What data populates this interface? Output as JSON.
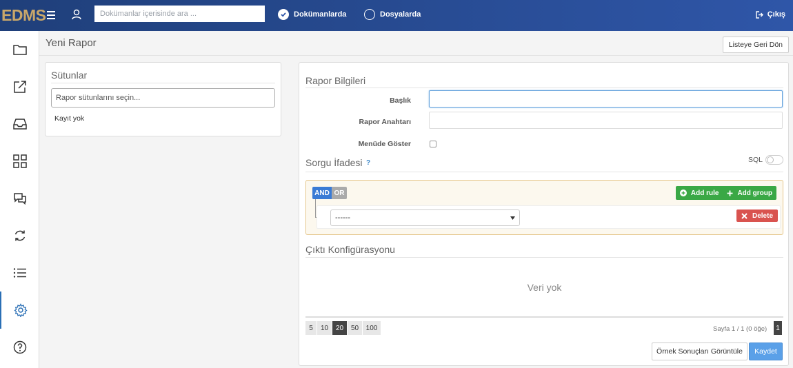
{
  "app": {
    "logo": "EDMS"
  },
  "topbar": {
    "search_placeholder": "Dokümanlar içerisinde ara ...",
    "radio_documents": "Dokümanlarda",
    "radio_files": "Dosyalarda",
    "logout": "Çıkış",
    "icons": [
      "menu-icon",
      "user-icon",
      "logout-icon"
    ]
  },
  "sidebar": {
    "items": [
      {
        "icon": "folder-icon"
      },
      {
        "icon": "share-icon"
      },
      {
        "icon": "inbox-icon"
      },
      {
        "icon": "grid-icon"
      },
      {
        "icon": "chat-icon"
      },
      {
        "icon": "sync-icon"
      },
      {
        "icon": "list-icon"
      },
      {
        "icon": "gear-icon",
        "active": true
      },
      {
        "icon": "help-icon"
      }
    ]
  },
  "header": {
    "title": "Yeni Rapor",
    "back_button": "Listeye Geri Dön"
  },
  "columns_panel": {
    "title": "Sütunlar",
    "input_placeholder": "Rapor sütunlarını seçin...",
    "empty": "Kayıt yok"
  },
  "report_info": {
    "title": "Rapor Bilgileri",
    "title_label": "Başlık",
    "title_value": "",
    "key_label": "Rapor Anahtarı",
    "key_value": "",
    "show_in_menu_label": "Menüde Göster"
  },
  "query": {
    "title": "Sorgu İfadesi",
    "help": "?",
    "sql_label": "SQL",
    "and_label": "AND",
    "or_label": "OR",
    "add_rule": "Add rule",
    "add_group": "Add group",
    "rule_select_value": "------",
    "delete": "Delete"
  },
  "output": {
    "title": "Çıktı Konfigürasyonu",
    "empty": "Veri yok",
    "page_sizes": [
      "5",
      "10",
      "20",
      "50",
      "100"
    ],
    "active_page_size": "20",
    "page_info": "Sayfa 1 / 1 (0 öğe)",
    "current_page": "1"
  },
  "actions": {
    "preview": "Örnek Sonuçları Görüntüle",
    "save": "Kaydet"
  },
  "colors": {
    "topbar_start": "#1f3f7a",
    "topbar_end": "#2f56a8",
    "logo": "#c9a76a",
    "add_green": "#3aa845",
    "delete_red": "#d9534f",
    "save_blue": "#5aa0e8"
  }
}
